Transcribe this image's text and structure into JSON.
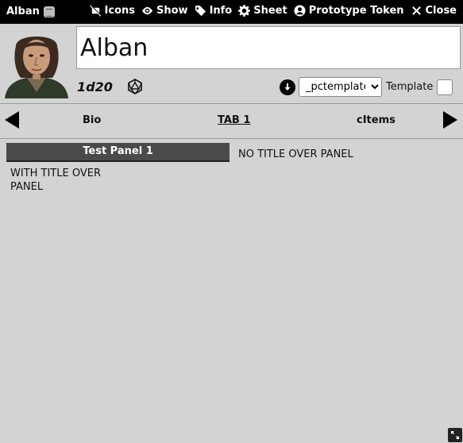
{
  "header": {
    "title": "Alban",
    "actions": [
      {
        "label": "Icons",
        "icon": "icons-slash-icon"
      },
      {
        "label": "Show",
        "icon": "eye-icon"
      },
      {
        "label": "Info",
        "icon": "tag-icon"
      },
      {
        "label": "Sheet",
        "icon": "gear-icon"
      },
      {
        "label": "Prototype Token",
        "icon": "user-circle-icon"
      },
      {
        "label": "Close",
        "icon": "close-icon"
      }
    ]
  },
  "character": {
    "name": "Alban",
    "dice_formula": "1d20"
  },
  "template": {
    "selected": "_pctemplate",
    "label": "Template",
    "checked": false
  },
  "tabs": [
    {
      "label": "Bio",
      "active": false
    },
    {
      "label": "TAB 1",
      "active": true
    },
    {
      "label": "cItems",
      "active": false
    }
  ],
  "panels": {
    "titled": {
      "title": "Test Panel 1",
      "body": "WITH TITLE OVER PANEL"
    },
    "untitled": {
      "body": "NO TITLE OVER PANEL"
    }
  }
}
